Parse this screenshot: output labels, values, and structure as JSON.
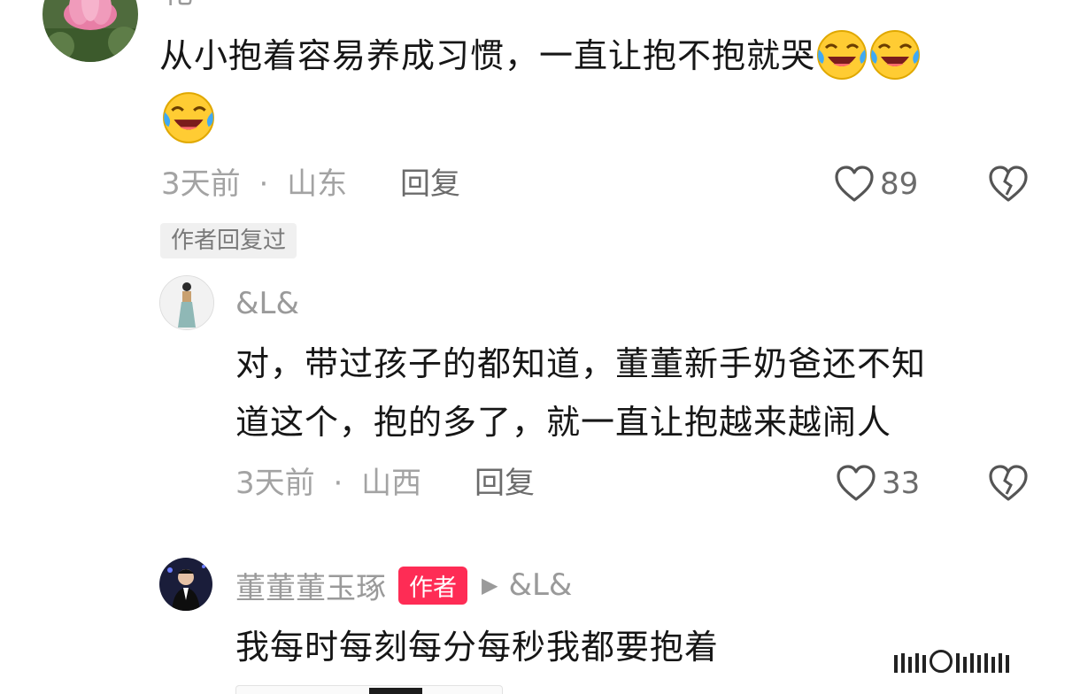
{
  "comment1": {
    "username_fragment": "花",
    "text_line1": "从小抱着容易养成习惯，一直让抱不抱就哭",
    "time": "3天前",
    "separator": "·",
    "location": "山东",
    "reply_label": "回复",
    "like_count": "89",
    "author_replied_badge": "作者回复过"
  },
  "reply1": {
    "username": "&L&",
    "text_line1": "对，带过孩子的都知道，董董新手奶爸还不知",
    "text_line2": "道这个，抱的多了，就一直让抱越来越闹人",
    "time": "3天前",
    "separator": "·",
    "location": "山西",
    "reply_label": "回复",
    "like_count": "33"
  },
  "reply2": {
    "username": "董董董玉琢",
    "author_badge": "作者",
    "arrow": "▶",
    "reply_to": "&L&",
    "text_line1": "我每时每刻每分每秒我都要抱着"
  },
  "icons": {
    "emoji": "laughing-crying-emoji-icon",
    "like": "heart-outline-icon",
    "dislike": "broken-heart-icon"
  },
  "colors": {
    "author_badge_bg": "#fe2c55",
    "meta_text": "#a3a3a3",
    "emoji_yellow": "#ffcc33"
  }
}
